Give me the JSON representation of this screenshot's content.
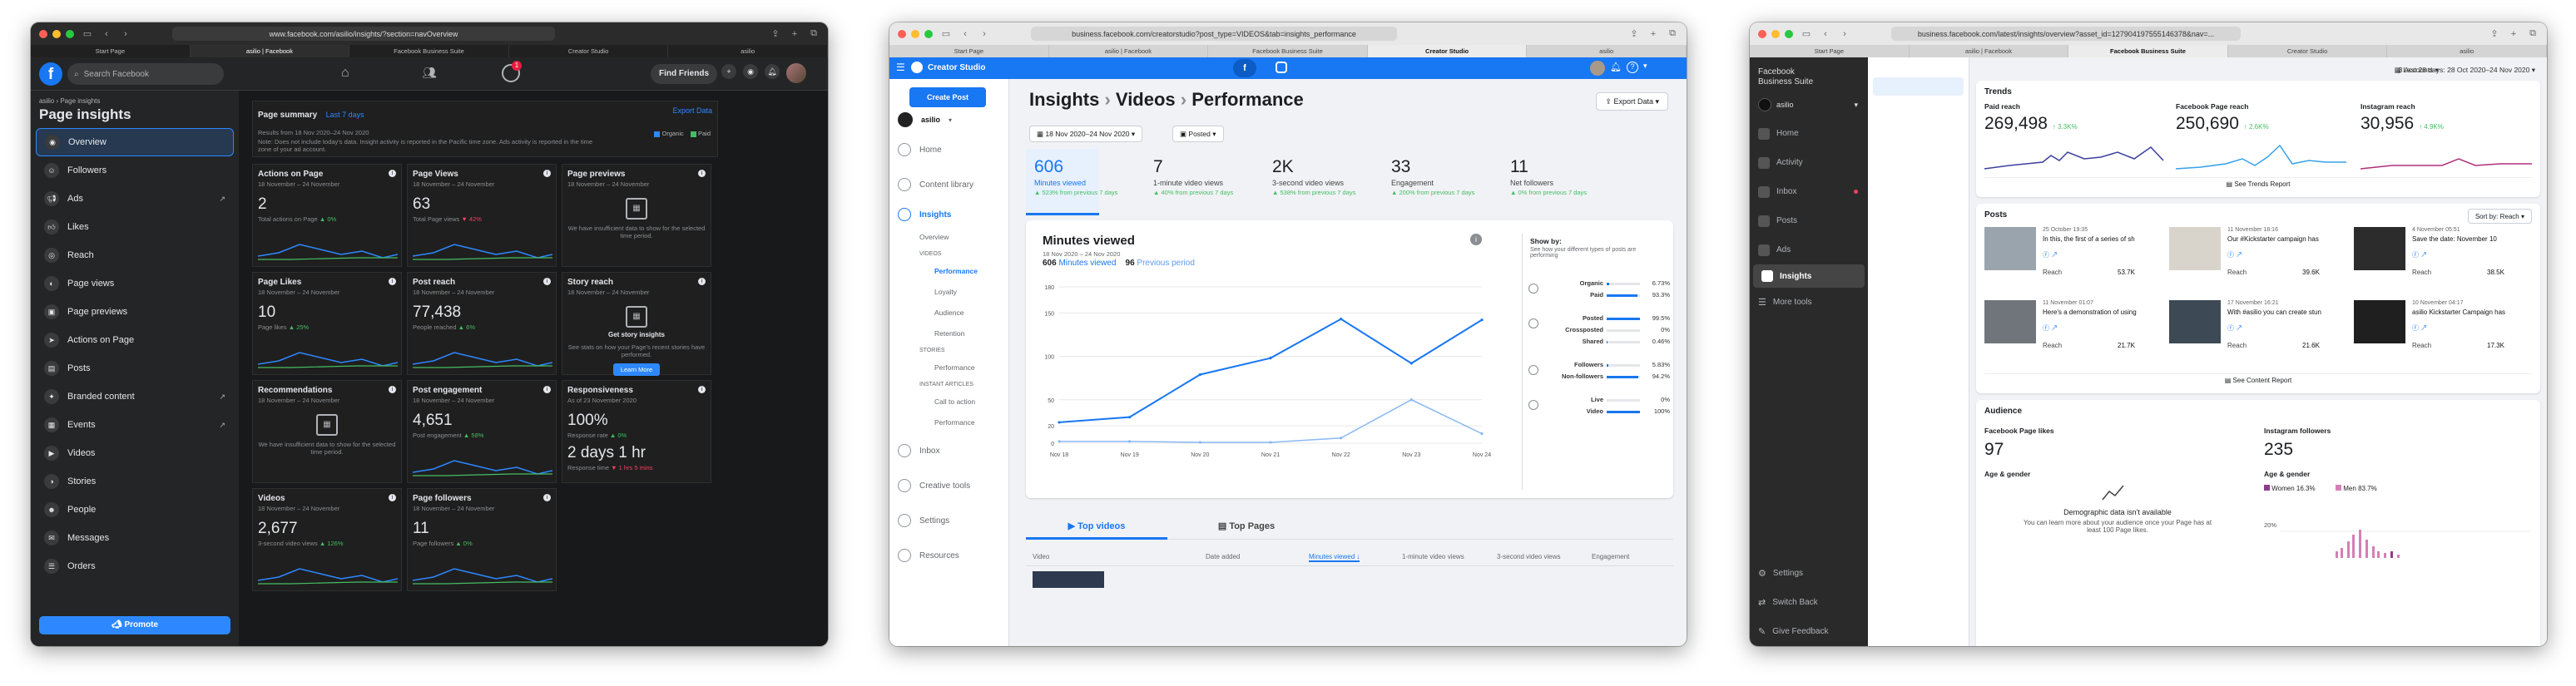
{
  "colors": {
    "fb_blue": "#1877f2",
    "creator_blue": "#1877f2",
    "green": "#45bd62",
    "red": "#f3425f"
  },
  "win1": {
    "url": "www.facebook.com/asilio/insights/?section=navOverview",
    "tabs": [
      "Start Page",
      "asilio | Facebook",
      "Facebook Business Suite",
      "Creator Studio",
      "asilio"
    ],
    "search_placeholder": "Search Facebook",
    "find_friends": "Find Friends",
    "notif_count": "1",
    "breadcrumb": "asilio › Page insights",
    "page_title": "Page insights",
    "nav": [
      "Overview",
      "Followers",
      "Ads",
      "Likes",
      "Reach",
      "Page views",
      "Page previews",
      "Actions on Page",
      "Posts",
      "Branded content",
      "Events",
      "Videos",
      "Stories",
      "People",
      "Messages",
      "Orders"
    ],
    "promote": "Promote",
    "summary_title": "Page summary",
    "summary_range": "Last 7 days",
    "export": "Export Data",
    "summary_note1": "Results from 18 Nov 2020–24 Nov 2020",
    "summary_note2": "Note: Does not include today's data. Insight activity is reported in the Pacific time zone. Ads activity is reported in the time zone of your ad account.",
    "legend_organic": "Organic",
    "legend_paid": "Paid",
    "cards": [
      {
        "title": "Actions on Page",
        "sub": "18 November – 24 November",
        "value": "2",
        "note_pre": "Total actions on Page",
        "delta": "▲ 0%",
        "dir": "g"
      },
      {
        "title": "Page Views",
        "sub": "18 November – 24 November",
        "value": "63",
        "note_pre": "Total Page views",
        "delta": "▼ 42%",
        "dir": "r"
      },
      {
        "title": "Page previews",
        "sub": "18 November – 24 November",
        "value": "",
        "note_pre": "We have insufficient data to show for the selected time period.",
        "delta": "",
        "dir": ""
      },
      {
        "title": "Page Likes",
        "sub": "18 November – 24 November",
        "value": "10",
        "note_pre": "Page likes",
        "delta": "▲ 25%",
        "dir": "g"
      },
      {
        "title": "Post reach",
        "sub": "18 November – 24 November",
        "value": "77,438",
        "note_pre": "People reached",
        "delta": "▲ 6%",
        "dir": "g"
      },
      {
        "title": "Story reach",
        "sub": "18 November – 24 November",
        "value": "",
        "note_pre": "See stats on how your Page's recent stories have performed.",
        "delta": "",
        "dir": ""
      },
      {
        "title": "Recommendations",
        "sub": "18 November – 24 November",
        "value": "",
        "note_pre": "We have insufficient data to show for the selected time period.",
        "delta": "",
        "dir": ""
      },
      {
        "title": "Post engagement",
        "sub": "18 November – 24 November",
        "value": "4,651",
        "note_pre": "Post engagement",
        "delta": "▲ 58%",
        "dir": "g"
      },
      {
        "title": "Responsiveness",
        "sub": "As of 23 November 2020",
        "value": "100%",
        "note_pre": "Response rate",
        "delta": "▲ 0%",
        "dir": "g"
      },
      {
        "title": "Videos",
        "sub": "18 November – 24 November",
        "value": "2,677",
        "note_pre": "3-second video views",
        "delta": "▲ 126%",
        "dir": "g"
      },
      {
        "title": "Page followers",
        "sub": "18 November – 24 November",
        "value": "11",
        "note_pre": "Page followers",
        "delta": "▲ 0%",
        "dir": "g"
      }
    ],
    "story_title": "Get story insights",
    "learn_more": "Learn More",
    "resp_time": "2 days 1 hr",
    "resp_time_label": "Response time",
    "resp_time_delta": "▼ 1 hrs 5 mins"
  },
  "win2": {
    "url": "business.facebook.com/creatorstudio?post_type=VIDEOS&tab=insights_performance",
    "tabs": [
      "Start Page",
      "asilio | Facebook",
      "Facebook Business Suite",
      "Creator Studio",
      "asilio"
    ],
    "app": "Creator Studio",
    "create_post": "Create Post",
    "page_name": "asilio",
    "nav": [
      "Home",
      "Content library",
      "Insights"
    ],
    "nav_sub": [
      "Overview",
      "VIDEOS",
      "Performance",
      "Loyalty",
      "Audience",
      "Retention",
      "STORIES",
      "Performance",
      "INSTANT ARTICLES",
      "Call to action",
      "Performance"
    ],
    "nav_bottom": [
      "Inbox",
      "Creative tools",
      "Settings",
      "Resources"
    ],
    "title": "Insights",
    "crumb2": "Videos",
    "crumb3": "Performance",
    "export": "Export Data",
    "date_range": "18 Nov 2020–24 Nov 2020",
    "posted": "Posted",
    "kpis": [
      {
        "v": "606",
        "l": "Minutes viewed",
        "d": "▲ 523% from previous 7 days"
      },
      {
        "v": "7",
        "l": "1-minute video views",
        "d": "▲ 40% from previous 7 days"
      },
      {
        "v": "2K",
        "l": "3-second video views",
        "d": "▲ 538% from previous 7 days"
      },
      {
        "v": "33",
        "l": "Engagement",
        "d": "▲ 200% from previous 7 days"
      },
      {
        "v": "11",
        "l": "Net followers",
        "d": "▲ 0% from previous 7 days"
      }
    ],
    "chart_title": "Minutes viewed",
    "chart_range": "18 Nov 2020 – 24 Nov 2020",
    "chart_total": "606",
    "chart_total_label": "Minutes viewed",
    "chart_prev": "96",
    "chart_prev_label": "Previous period",
    "show_by": "Show by:",
    "show_by_note": "See how your different types of posts are performing",
    "breakdown": [
      {
        "label": "Organic",
        "pct": "6.73%",
        "v": 6.73
      },
      {
        "label": "Paid",
        "pct": "93.3%",
        "v": 93.3
      },
      {
        "label": "Posted",
        "pct": "99.5%",
        "v": 99.5
      },
      {
        "label": "Crossposted",
        "pct": "0%",
        "v": 0
      },
      {
        "label": "Shared",
        "pct": "0.46%",
        "v": 0.46
      },
      {
        "label": "Followers",
        "pct": "5.83%",
        "v": 5.83
      },
      {
        "label": "Non-followers",
        "pct": "94.2%",
        "v": 94.2
      },
      {
        "label": "Live",
        "pct": "0%",
        "v": 0
      },
      {
        "label": "Video",
        "pct": "100%",
        "v": 100
      }
    ],
    "tab_top_videos": "Top videos",
    "tab_top_pages": "Top Pages",
    "cols": [
      "Video",
      "Date added",
      "Minutes viewed",
      "1-minute video views",
      "3-second video views",
      "Engagement"
    ]
  },
  "win3": {
    "url": "business.facebook.com/latest/insights/overview?asset_id=127904197555146378&nav=...",
    "tabs": [
      "Start Page",
      "asilio | Facebook",
      "Facebook Business Suite",
      "Creator Studio",
      "asilio"
    ],
    "brand1": "Facebook",
    "brand2": "Business Suite",
    "account": "asilio",
    "nav": [
      "Home",
      "Activity",
      "Inbox",
      "Posts",
      "Ads",
      "Insights",
      "More tools"
    ],
    "nav_bottom": [
      "Settings",
      "Switch Back",
      "Give Feedback"
    ],
    "accounts": "3 Accounts",
    "range": "Last 28 days: 28 Oct 2020–24 Nov 2020",
    "trends_title": "Trends",
    "trends": [
      {
        "label": "Paid reach",
        "value": "269,498",
        "delta": "↑ 3.3K%"
      },
      {
        "label": "Facebook Page reach",
        "value": "250,690",
        "delta": "↑ 2.6K%"
      },
      {
        "label": "Instagram reach",
        "value": "30,956",
        "delta": "↑ 4.9K%"
      }
    ],
    "see_trends": "See Trends Report",
    "posts_title": "Posts",
    "sort": "Sort by: Reach",
    "posts": [
      {
        "date": "25 October 19:35",
        "title": "In this, the first of a series of sh",
        "reach": "53.7K"
      },
      {
        "date": "11 November 18:16",
        "title": "Our #Kickstarter campaign has",
        "reach": "39.6K"
      },
      {
        "date": "4 November 05:51",
        "title": "Save the date: November 10",
        "reach": "38.5K"
      },
      {
        "date": "11 November 01:07",
        "title": "Here's a demonstration of using",
        "reach": "21.7K"
      },
      {
        "date": "17 November 16:21",
        "title": "With #asilio you can create stun",
        "reach": "21.6K"
      },
      {
        "date": "10 November 04:17",
        "title": "asilio Kickstarter Campaign has",
        "reach": "17.3K"
      }
    ],
    "reach_label": "Reach",
    "see_content": "See Content Report",
    "audience_title": "Audience",
    "fb_likes_label": "Facebook Page likes",
    "fb_likes": "97",
    "ig_followers_label": "Instagram followers",
    "ig_followers": "235",
    "age_gender": "Age & gender",
    "demo_title": "Demographic data isn't available",
    "demo_note": "You can learn more about your audience once your Page has at least 100 Page likes.",
    "women": "Women",
    "women_pct": "16.3%",
    "men": "Men",
    "men_pct": "83.7%",
    "ig_axis": "20%"
  },
  "chart_data": [
    {
      "type": "line",
      "title": "Minutes viewed",
      "categories": [
        "Nov 18",
        "Nov 19",
        "Nov 20",
        "Nov 21",
        "Nov 22",
        "Nov 23",
        "Nov 24"
      ],
      "yticks": [
        0,
        20,
        50,
        100,
        150,
        180
      ],
      "ylim": [
        0,
        180
      ],
      "series": [
        {
          "name": "Minutes viewed",
          "values": [
            24,
            30,
            79,
            98,
            143,
            92,
            142
          ]
        },
        {
          "name": "Previous period",
          "values": [
            2,
            2,
            1,
            1,
            6,
            50,
            11
          ]
        }
      ],
      "grid": true
    }
  ]
}
